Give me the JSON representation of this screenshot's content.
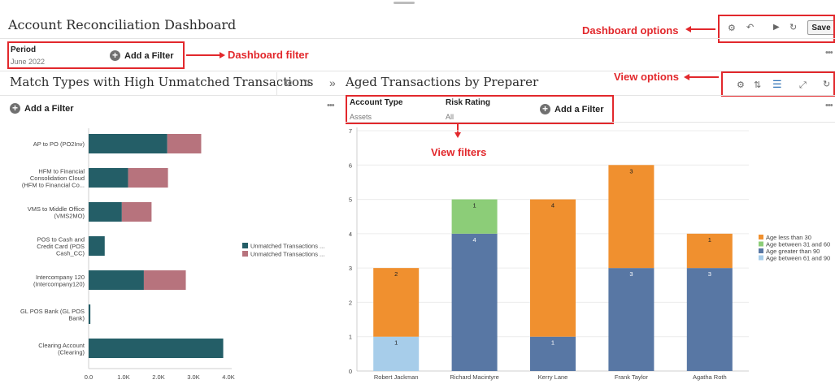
{
  "header": {
    "title": "Account Reconciliation Dashboard",
    "save_label": "Save"
  },
  "dashboard_filter": {
    "label": "Period",
    "value": "June 2022",
    "add_label": "Add a Filter"
  },
  "left_view": {
    "title": "Match Types with High Unmatched Transactions",
    "add_label": "Add a Filter"
  },
  "right_view": {
    "title": "Aged Transactions by Preparer",
    "filters": [
      {
        "label": "Account Type",
        "value": "Assets"
      },
      {
        "label": "Risk Rating",
        "value": "All"
      }
    ],
    "add_label": "Add a Filter"
  },
  "annotations": {
    "dashboard_options": "Dashboard options",
    "dashboard_filter": "Dashboard filter",
    "view_options": "View options",
    "view_filters": "View filters"
  },
  "colors": {
    "teal": "#245e67",
    "mauve": "#b7737d",
    "orange": "#f0902f",
    "green": "#8ccd78",
    "darkblue": "#5877a4",
    "lightblue": "#a7cdea",
    "callout_red": "#e2282c"
  },
  "chart_data": [
    {
      "type": "bar",
      "orientation": "horizontal",
      "stacked": true,
      "categories": [
        [
          "AP to PO (PO2Inv)"
        ],
        [
          "HFM to Financial",
          "Consolidation Cloud",
          "(HFM to Financial Co..."
        ],
        [
          "VMS to Middle Office",
          "(VMS2MO)"
        ],
        [
          "POS to Cash and",
          "Credit Card (POS",
          "Cash_CC)"
        ],
        [
          "Intercompany 120",
          "(Intercompany120)"
        ],
        [
          "GL POS Bank (GL POS",
          "Bank)"
        ],
        [
          "Clearing Account",
          "(Clearing)"
        ]
      ],
      "series": [
        {
          "name": "Unmatched Transactions ...",
          "color": "#245e67",
          "values": [
            2250,
            1130,
            950,
            460,
            1580,
            50,
            3850
          ]
        },
        {
          "name": "Unmatched Transactions ...",
          "color": "#b7737d",
          "values": [
            970,
            1140,
            850,
            0,
            1200,
            0,
            0
          ]
        }
      ],
      "x_ticks": [
        "0.0",
        "1.0K",
        "2.0K",
        "3.0K",
        "4.0K"
      ],
      "xlim": [
        0,
        4000
      ],
      "grid": false,
      "legend": "right"
    },
    {
      "type": "bar",
      "stacked": true,
      "categories": [
        "Robert Jackman",
        "Richard Macintyre",
        "Kerry Lane",
        "Frank Taylor",
        "Agatha Roth"
      ],
      "series": [
        {
          "name": "Age between 61 and 90",
          "color": "#a7cdea",
          "values": [
            1,
            0,
            0,
            0,
            0
          ]
        },
        {
          "name": "Age greater than 90",
          "color": "#5877a4",
          "values": [
            0,
            4,
            1,
            3,
            3
          ]
        },
        {
          "name": "Age less than 30",
          "color": "#f0902f",
          "values": [
            2,
            0,
            4,
            3,
            1
          ]
        },
        {
          "name": "Age between 31 and 60",
          "color": "#8ccd78",
          "values": [
            0,
            1,
            0,
            0,
            0
          ]
        }
      ],
      "legend_order": [
        "Age less than 30",
        "Age between 31 and 60",
        "Age greater than 90",
        "Age between 61 and 90"
      ],
      "y_ticks": [
        "0",
        "1",
        "2",
        "3",
        "4",
        "5",
        "6",
        "7"
      ],
      "ylim": [
        0,
        7
      ],
      "grid": true,
      "legend": "right"
    }
  ]
}
